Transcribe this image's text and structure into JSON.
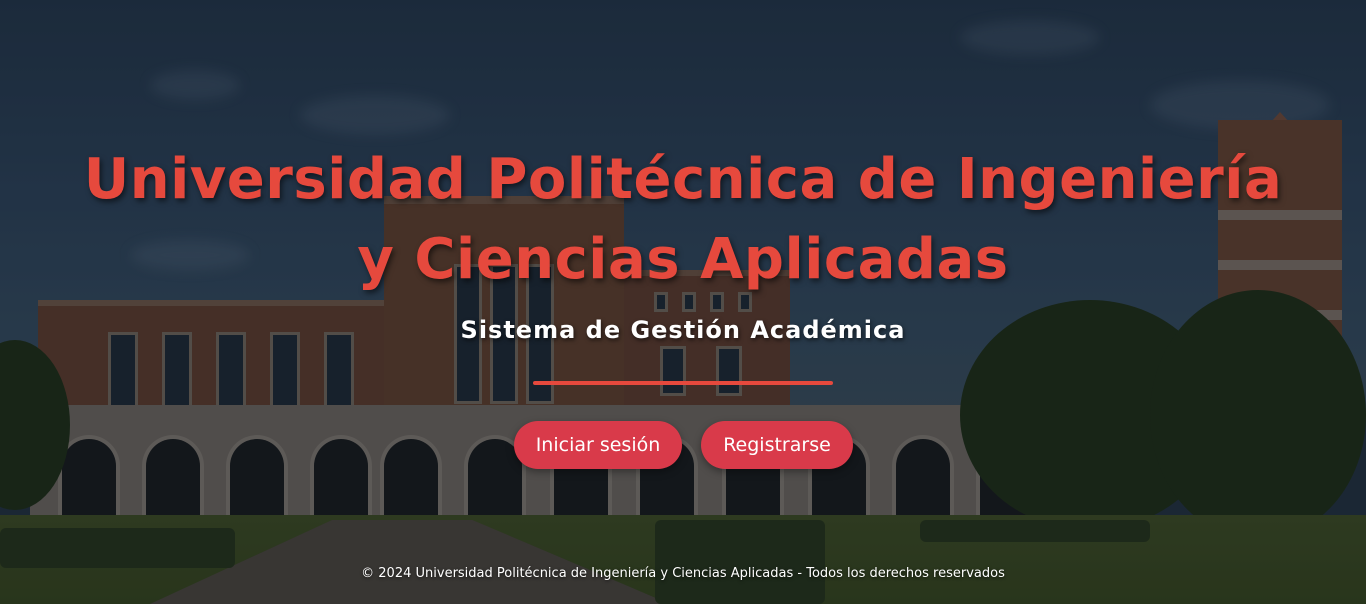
{
  "hero": {
    "title": "Universidad Politécnica de Ingeniería y Ciencias Aplicadas",
    "subtitle": "Sistema de Gestión Académica"
  },
  "actions": {
    "login_label": "Iniciar sesión",
    "register_label": "Registrarse"
  },
  "footer": {
    "copyright": "© 2024 Universidad Politécnica de Ingeniería y Ciencias Aplicadas - Todos los derechos reservados"
  },
  "colors": {
    "title": "#e6493d",
    "button": "#d93a4a",
    "divider": "#e6493d",
    "text": "#ffffff"
  }
}
